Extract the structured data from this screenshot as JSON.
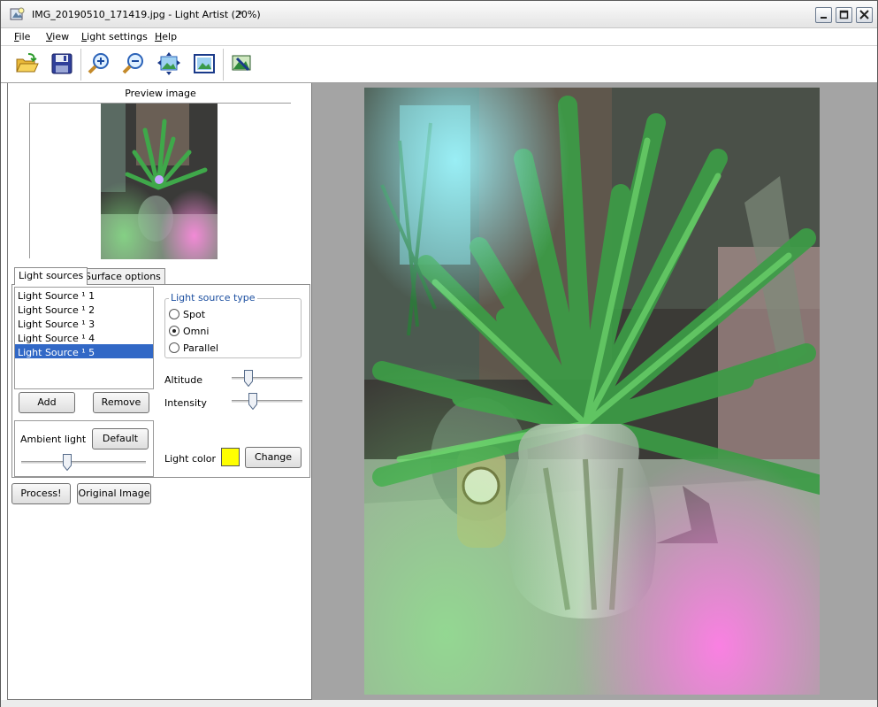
{
  "window": {
    "title": "IMG_20190510_171419.jpg - Light Artist (20%)",
    "modified_marker": "*",
    "icons": {
      "app": "light-artist-app-icon",
      "minimize": "minimize-icon",
      "maximize": "maximize-icon",
      "close": "close-icon"
    }
  },
  "menu": {
    "file": {
      "mnemonic": "F",
      "rest": "ile"
    },
    "view": {
      "mnemonic": "V",
      "rest": "iew"
    },
    "light_settings": {
      "mnemonic": "L",
      "rest": "ight settings"
    },
    "help": {
      "mnemonic": "H",
      "rest": "elp"
    }
  },
  "toolbar": {
    "buttons": [
      {
        "icon": "open-folder-icon"
      },
      {
        "icon": "save-disk-icon"
      },
      {
        "icon": "zoom-in-icon"
      },
      {
        "icon": "zoom-out-icon"
      },
      {
        "icon": "fit-to-window-icon"
      },
      {
        "icon": "actual-size-icon"
      },
      {
        "icon": "edit-image-icon"
      }
    ]
  },
  "left": {
    "preview_label": "Preview image",
    "tabs": [
      "Light sources",
      "Surface options"
    ],
    "light_sources": [
      "Light Source ¹ 1",
      "Light Source ¹ 2",
      "Light Source ¹ 3",
      "Light Source ¹ 4",
      "Light Source ¹ 5"
    ],
    "selected_source_index": 4,
    "add_label": "Add",
    "remove_label": "Remove",
    "ambient_label": "Ambient light",
    "default_label": "Default",
    "ambient_level": 0.36,
    "type_group_label": "Light source type",
    "type_options": [
      "Spot",
      "Omni",
      "Parallel"
    ],
    "type_selected": "Omni",
    "altitude_label": "Altitude",
    "altitude_level": 0.2,
    "intensity_label": "Intensity",
    "intensity_level": 0.27,
    "light_color_label": "Light color",
    "light_color": "#ffff00",
    "change_label": "Change",
    "process_label": "Process!",
    "original_label": "Original Image"
  },
  "colors": {
    "selection": "#3168c6",
    "group_label": "#1c4fa0",
    "image_background": "#a4a4a4"
  }
}
